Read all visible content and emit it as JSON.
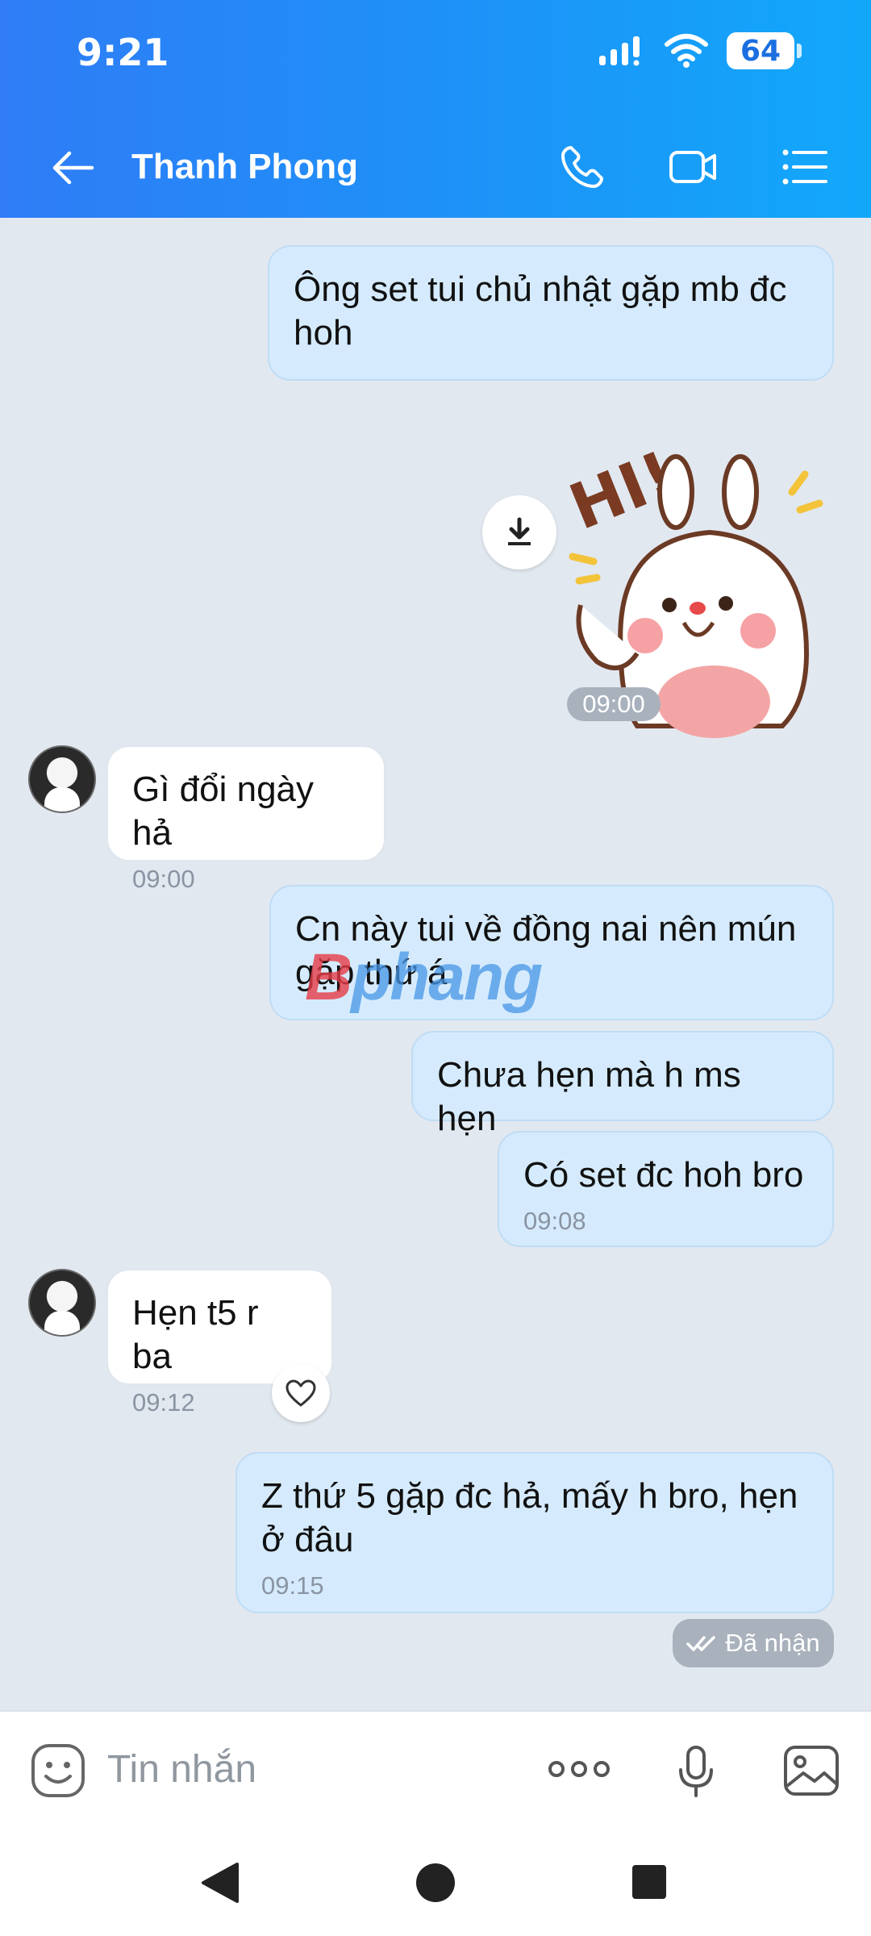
{
  "status_bar": {
    "time": "9:21",
    "battery": "64"
  },
  "header": {
    "title": "Thanh Phong",
    "icons": [
      "back-arrow-icon",
      "phone-icon",
      "video-call-icon",
      "menu-list-icon"
    ]
  },
  "messages": {
    "m1": {
      "text": "Ông set tui chủ nhật gặp mb đc hoh"
    },
    "sticker_time": "09:00",
    "m2": {
      "text": "Gì đổi ngày hả",
      "time": "09:00"
    },
    "m3": {
      "text": "Cn này tui về đồng nai nên mún gặp thứ á"
    },
    "m4": {
      "text": "Chưa hẹn mà h ms hẹn"
    },
    "m5": {
      "text": "Có set đc hoh bro",
      "time": "09:08"
    },
    "m6": {
      "text": "Hẹn t5 r ba",
      "time": "09:12"
    },
    "m7": {
      "text": "Z thứ 5 gặp đc hả, mấy h bro, hẹn ở đâu",
      "time": "09:15"
    },
    "status": "Đã nhận"
  },
  "watermark": {
    "prefix": "B",
    "rest": "phang"
  },
  "composer": {
    "placeholder": "Tin nhắn"
  },
  "colors": {
    "header_start": "#2f7cf6",
    "header_end": "#12a8fa",
    "outgoing_bubble": "#d5ebfd",
    "chat_bg": "#e2e8f0"
  }
}
